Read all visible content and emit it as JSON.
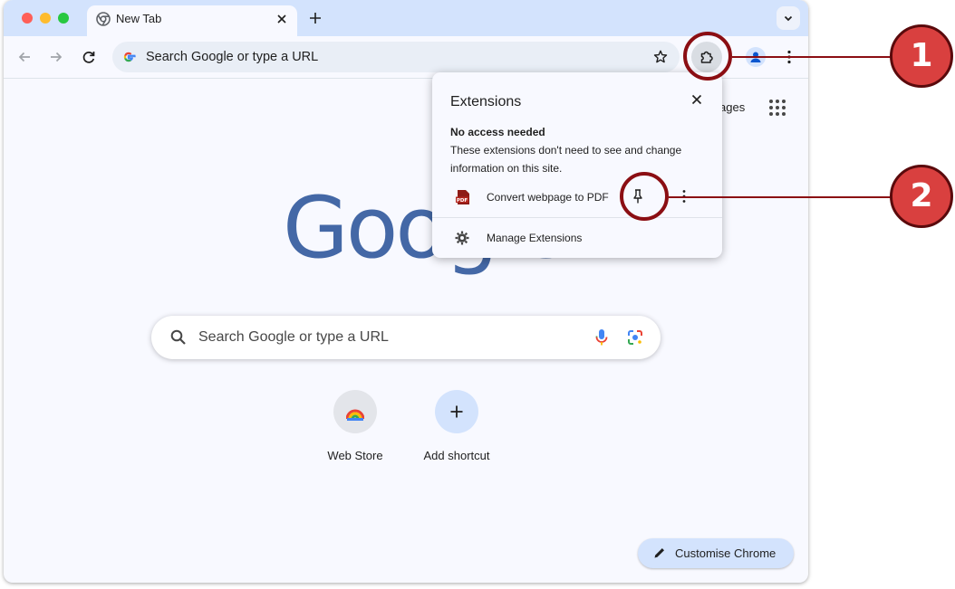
{
  "tab": {
    "title": "New Tab"
  },
  "omnibox": {
    "placeholder": "Search Google or type a URL"
  },
  "ntp": {
    "top_link_visible": "ages",
    "logo_text": "Google",
    "search_placeholder": "Search Google or type a URL",
    "shortcuts": [
      {
        "label": "Web Store"
      },
      {
        "label": "Add shortcut"
      }
    ],
    "customise_label": "Customise Chrome"
  },
  "extensions_popup": {
    "title": "Extensions",
    "subheading": "No access needed",
    "description": "These extensions don't need to see and change information on this site.",
    "extension": {
      "name": "Convert webpage to PDF",
      "icon_label": "PDF"
    },
    "manage_label": "Manage Extensions"
  },
  "callouts": [
    {
      "label": "1"
    },
    {
      "label": "2"
    }
  ],
  "colors": {
    "tabstrip": "#d3e3fd",
    "callout_fill": "#d9403f",
    "callout_ring": "#8b0e13",
    "google_logo": "#4468a6"
  },
  "icons": [
    "chrome-icon",
    "close-icon",
    "plus-icon",
    "chevron-down-icon",
    "back-arrow-icon",
    "forward-arrow-icon",
    "reload-icon",
    "google-g-icon",
    "star-icon",
    "puzzle-icon",
    "profile-icon",
    "kebab-menu-icon",
    "apps-grid-icon",
    "search-icon",
    "mic-icon",
    "lens-icon",
    "pencil-icon",
    "pdf-icon",
    "pin-icon",
    "gear-icon"
  ]
}
